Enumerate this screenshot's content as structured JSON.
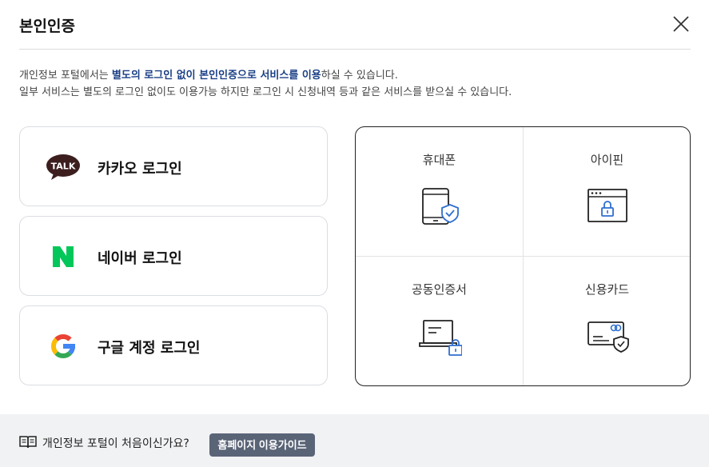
{
  "modal": {
    "title": "본인인증"
  },
  "description": {
    "line1_pre": "개인정보 포털에서는 ",
    "line1_highlight": "별도의 로그인 없이 본인인증으로 서비스를 이용",
    "line1_post": "하실 수 있습니다.",
    "line2": "일부 서비스는 별도의 로그인 없이도 이용가능 하지만 로그인 시 신청내역 등과 같은 서비스를 받으실 수 있습니다."
  },
  "social_logins": [
    {
      "label": "카카오 로그인",
      "icon": "kakao-talk-icon",
      "logo_text": "TALK"
    },
    {
      "label": "네이버 로그인",
      "icon": "naver-icon",
      "logo_text": "N"
    },
    {
      "label": "구글 계정 로그인",
      "icon": "google-icon",
      "logo_text": "G"
    }
  ],
  "auth_methods": [
    {
      "label": "휴대폰",
      "icon": "mobile-phone-icon"
    },
    {
      "label": "아이핀",
      "icon": "ipin-icon"
    },
    {
      "label": "공동인증서",
      "icon": "certificate-laptop-icon"
    },
    {
      "label": "신용카드",
      "icon": "credit-card-icon"
    }
  ],
  "footer": {
    "question": "개인정보 포털이 처음이신가요?",
    "guide_button": "홈페이지 이용가이드"
  },
  "colors": {
    "highlight": "#1a3f86",
    "icon_blue": "#2f6fd0",
    "kakao_brown": "#3c1e1e",
    "naver_green": "#03c75a",
    "footer_bg": "#f1f2f4",
    "guide_button_bg": "#5a6477"
  }
}
